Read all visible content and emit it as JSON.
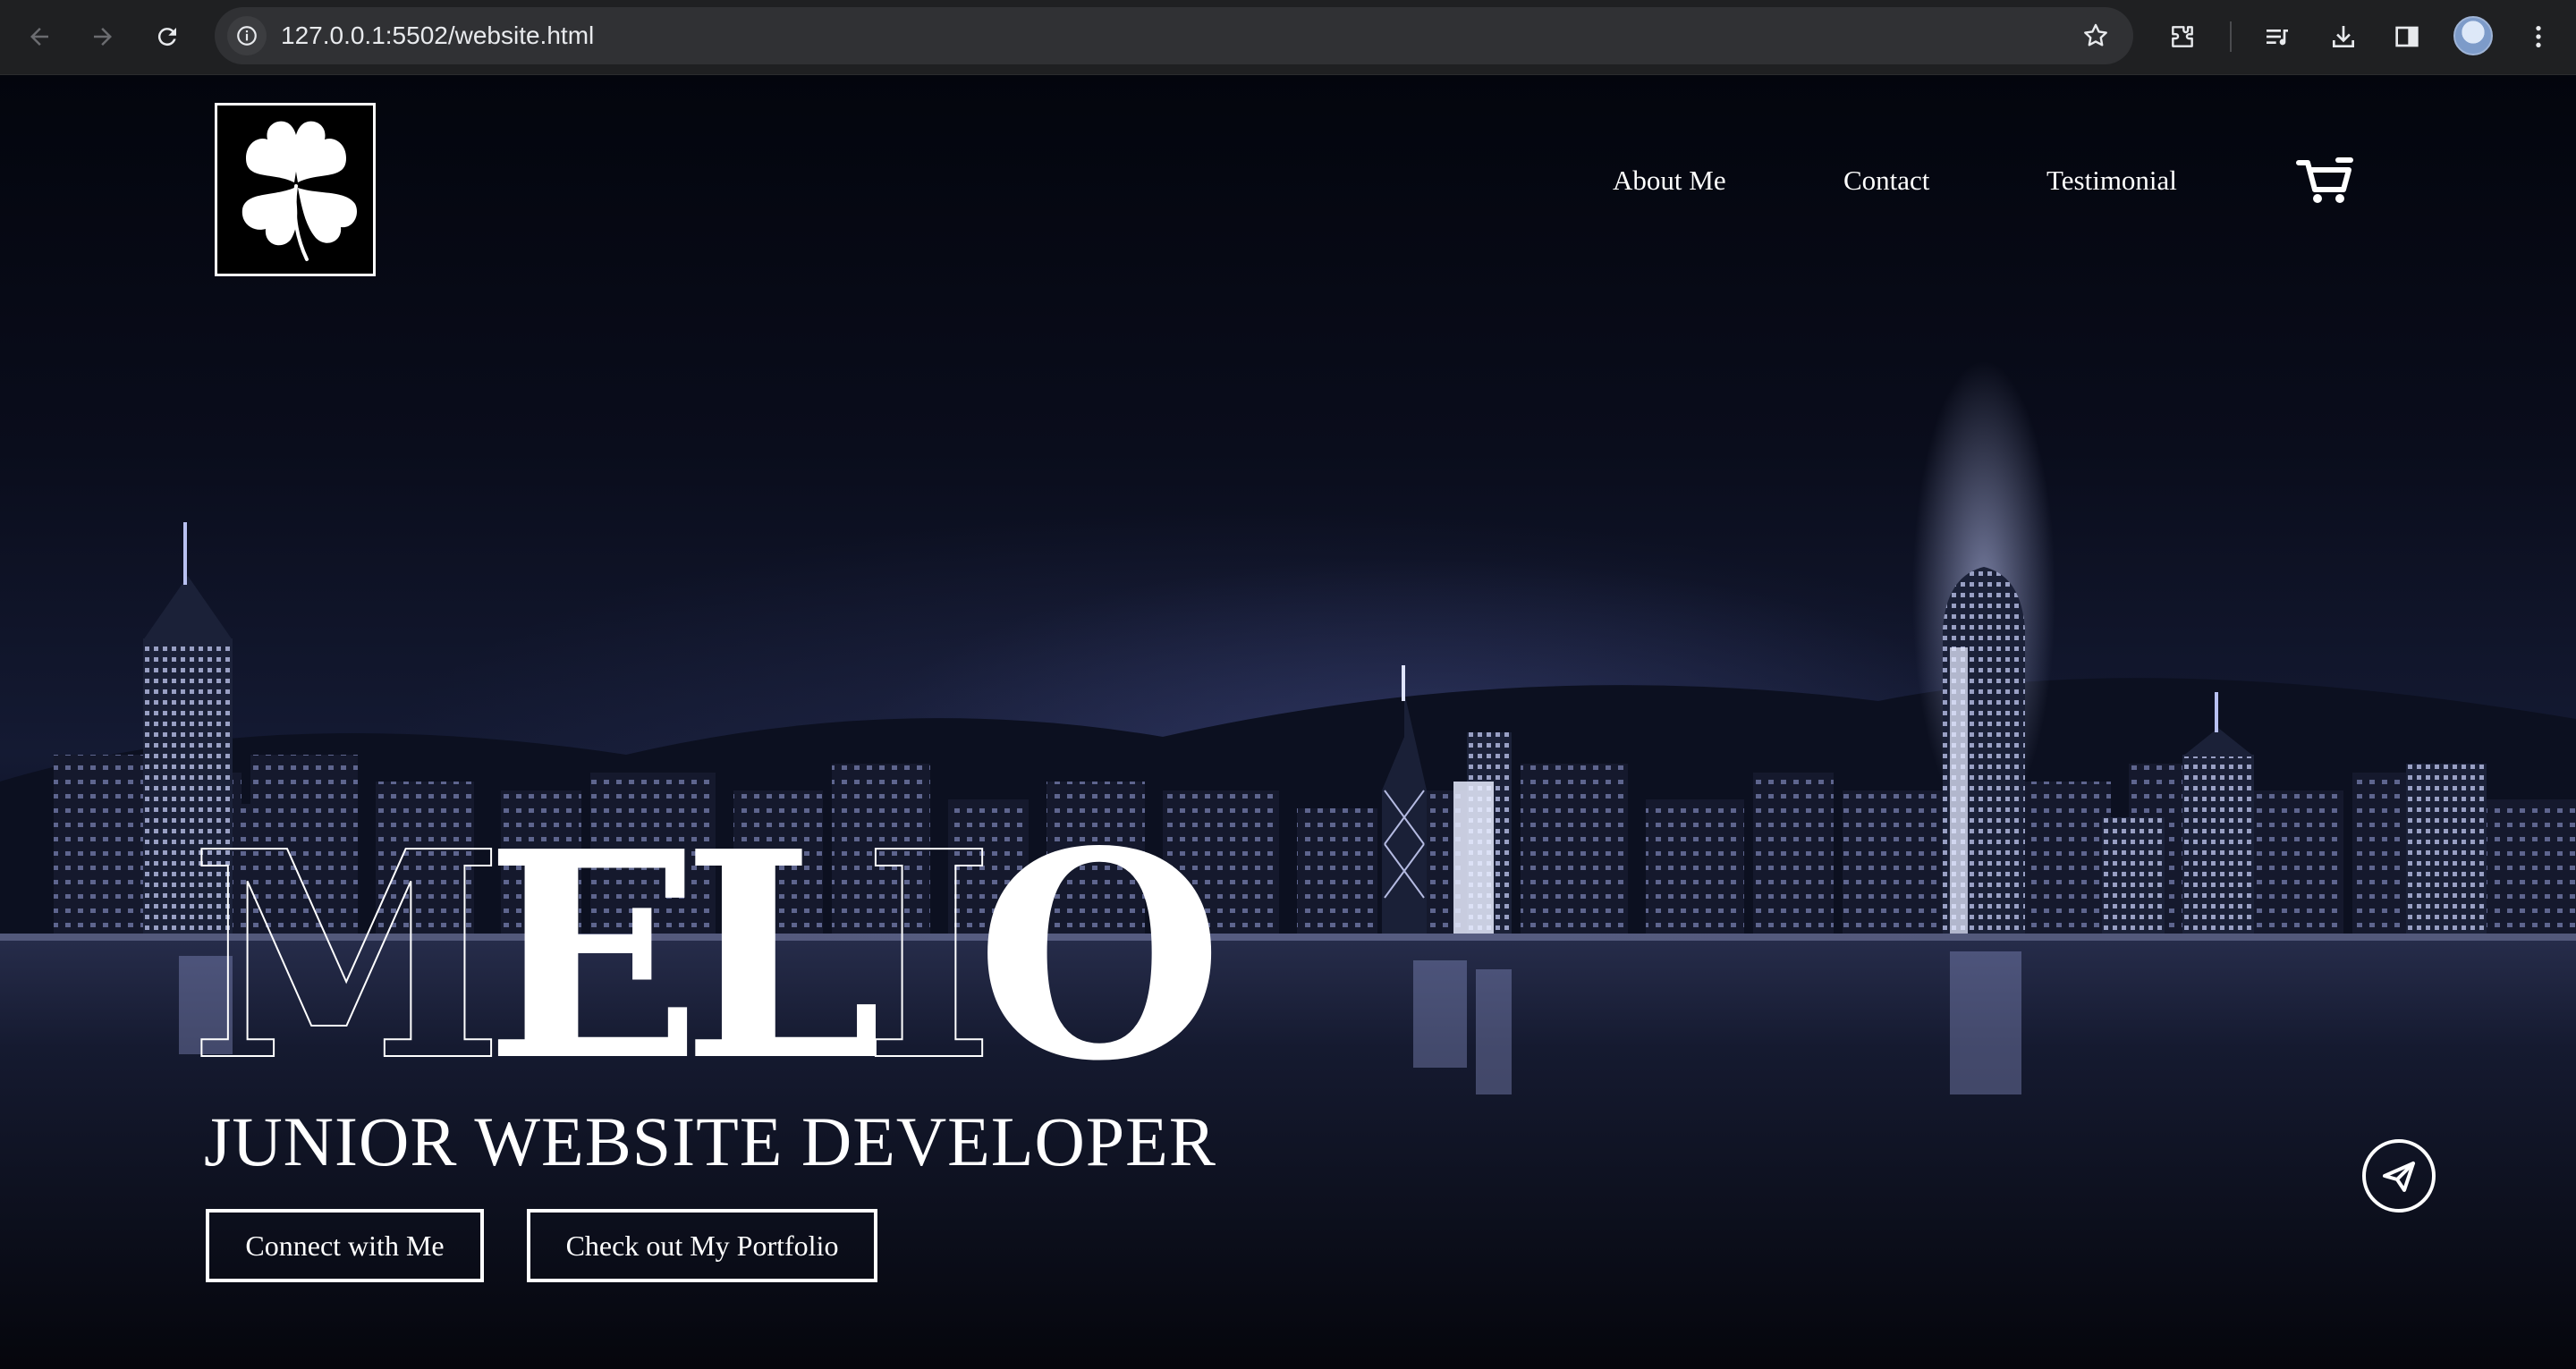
{
  "browser": {
    "url": "127.0.0.1:5502/website.html",
    "icons": [
      "back-arrow-icon",
      "forward-arrow-icon",
      "reload-icon",
      "site-info-icon",
      "bookmark-star-icon",
      "extensions-icon",
      "reading-list-icon",
      "download-icon",
      "side-panel-icon",
      "profile-avatar",
      "more-menu-icon"
    ]
  },
  "header": {
    "logo_icon": "four-leaf-clover-icon",
    "nav": [
      {
        "label": "About Me"
      },
      {
        "label": "Contact"
      },
      {
        "label": "Testimonial"
      }
    ],
    "cart_icon": "shopping-cart-icon"
  },
  "hero": {
    "brand": "MELIO",
    "subtitle": "JUNIOR WEBSITE DEVELOPER",
    "buttons": [
      {
        "label": "Connect with Me"
      },
      {
        "label": "Check out My Portfolio"
      }
    ],
    "floating_icon": "send-paper-plane-icon",
    "background": "night city skyline over water"
  },
  "colors": {
    "chrome": "#1f2022",
    "omnibox": "#303134",
    "page_text": "#ffffff",
    "background": "#050711",
    "city_light": "#8f9ad6"
  }
}
